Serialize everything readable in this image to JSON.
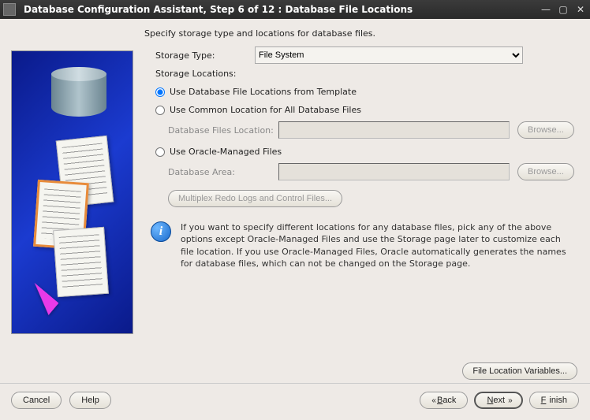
{
  "titlebar": {
    "title": "Database Configuration Assistant, Step 6 of 12 : Database File Locations"
  },
  "main": {
    "intro": "Specify storage type and locations for database files.",
    "storage_type_label": "Storage Type:",
    "storage_type_value": "File System",
    "storage_locations_label": "Storage Locations:",
    "radio1": "Use Database File Locations from Template",
    "radio2": "Use Common Location for All Database Files",
    "db_files_loc_label": "Database Files Location:",
    "db_files_loc_value": "",
    "browse": "Browse...",
    "radio3": "Use Oracle-Managed Files",
    "db_area_label": "Database Area:",
    "db_area_value": "",
    "multiplex_btn": "Multiplex Redo Logs and Control Files...",
    "info_text": "If you want to specify different locations for any database files, pick any of the above options except Oracle-Managed Files and use the Storage page later to customize each file location. If you use Oracle-Managed Files, Oracle automatically generates the names for database files, which can not be changed on the Storage page."
  },
  "file_loc_btn": "File Location Variables...",
  "footer": {
    "cancel": "Cancel",
    "help": "Help",
    "back": "Back",
    "next": "Next",
    "finish": "Finish"
  }
}
